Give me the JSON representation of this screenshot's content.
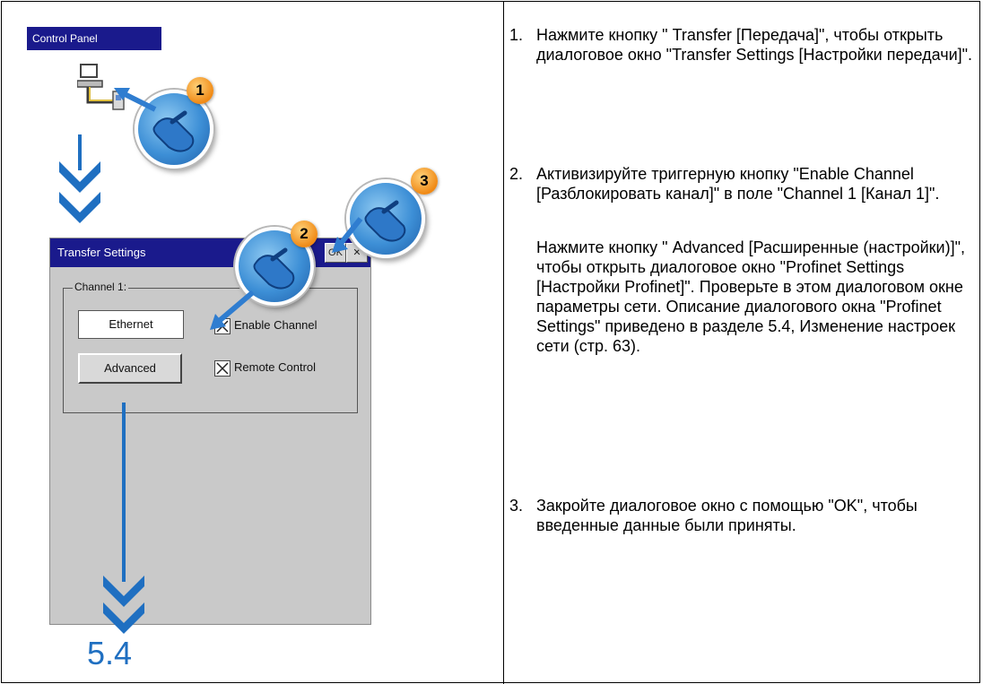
{
  "illustration": {
    "control_panel_title": "Control Panel",
    "badges": [
      "1",
      "2",
      "3"
    ],
    "dialog": {
      "title": "Transfer Settings",
      "ok_label": "OK",
      "close_glyph": "✕",
      "group_label": "Channel 1:",
      "field_value": "Ethernet",
      "advanced_label": "Advanced",
      "enable_channel_label": "Enable Channel",
      "remote_control_label": "Remote Control",
      "enable_channel_checked": true,
      "remote_control_checked": true
    },
    "reference_label": "5.4",
    "accent_color": "#1f6fc1",
    "titlebar_color": "#1a1a8c"
  },
  "steps": [
    {
      "number": "1.",
      "paragraphs": [
        "Нажмите кнопку  \" Transfer [Передача]\", чтобы открыть диалоговое окно \"Transfer Settings [Настройки передачи]\"."
      ]
    },
    {
      "number": "2.",
      "paragraphs": [
        "Активизируйте триггерную кнопку \"Enable Channel [Разблокировать канал]\" в поле \"Channel 1 [Канал 1]\".",
        "Нажмите кнопку  \" Advanced [Расширенные (настройки)]\", чтобы открыть диалоговое окно \"Profinet Settings [Настройки Profinet]\". Проверьте в этом диалоговом окне параметры сети. Описание диалогового окна \"Profinet Settings\" приведено в разделе 5.4, Изменение настроек сети (стр. 63)."
      ]
    },
    {
      "number": "3.",
      "paragraphs": [
        "Закройте диалоговое окно с помощью \"OK\", чтобы введенные данные были приняты."
      ]
    }
  ]
}
